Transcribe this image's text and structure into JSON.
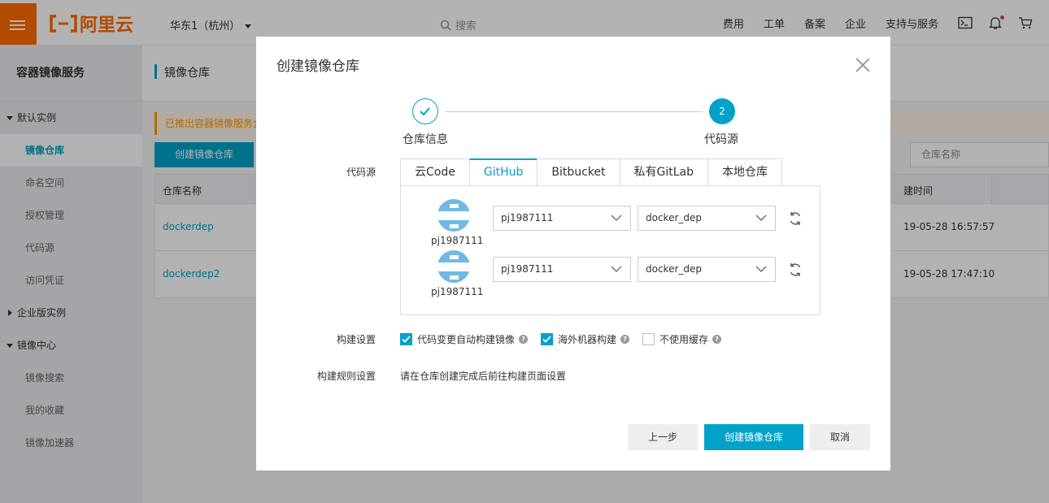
{
  "topbar": {
    "logo_text": "阿里云",
    "region": "华东1（杭州）",
    "search_placeholder": "搜索",
    "nav": [
      "费用",
      "工单",
      "备案",
      "企业",
      "支持与服务"
    ]
  },
  "sidebar": {
    "title": "容器镜像服务",
    "groups": [
      {
        "label": "默认实例",
        "expanded": true,
        "items": [
          "镜像仓库",
          "命名空间",
          "授权管理",
          "代码源",
          "访问凭证"
        ]
      },
      {
        "label": "企业版实例",
        "expanded": false,
        "items": []
      },
      {
        "label": "镜像中心",
        "expanded": true,
        "items": [
          "镜像搜索",
          "我的收藏",
          "镜像加速器"
        ]
      }
    ],
    "active_item": "镜像仓库"
  },
  "main": {
    "page_title": "镜像仓库",
    "notice": "已推出容器镜像服务企",
    "create_button": "创建镜像仓库",
    "search_placeholder": "仓库名称",
    "table": {
      "headers": [
        "仓库名称",
        "建时间"
      ],
      "rows": [
        {
          "name": "dockerdep",
          "time": "19-05-28 16:57:57"
        },
        {
          "name": "dockerdep2",
          "time": "19-05-28 17:47:10"
        }
      ]
    }
  },
  "modal": {
    "title": "创建镜像仓库",
    "steps": [
      {
        "label": "仓库信息",
        "status": "done"
      },
      {
        "label": "代码源",
        "status": "current",
        "number": "2"
      }
    ],
    "code_source_label": "代码源",
    "tabs": [
      "云Code",
      "GitHub",
      "Bitbucket",
      "私有GitLab",
      "本地仓库"
    ],
    "active_tab": "GitHub",
    "sources": [
      {
        "account": "pj1987111",
        "org": "pj1987111",
        "repo": "docker_dep"
      },
      {
        "account": "pj1987111",
        "org": "pj1987111",
        "repo": "docker_dep"
      }
    ],
    "build_settings_label": "构建设置",
    "build_options": [
      {
        "label": "代码变更自动构建镜像",
        "checked": true
      },
      {
        "label": "海外机器构建",
        "checked": true
      },
      {
        "label": "不使用缓存",
        "checked": false
      }
    ],
    "build_rules_label": "构建规则设置",
    "build_rules_text": "请在仓库创建完成后前往构建页面设置",
    "buttons": {
      "prev": "上一步",
      "create": "创建镜像仓库",
      "cancel": "取消"
    },
    "accent_color": "#00a2ca"
  }
}
